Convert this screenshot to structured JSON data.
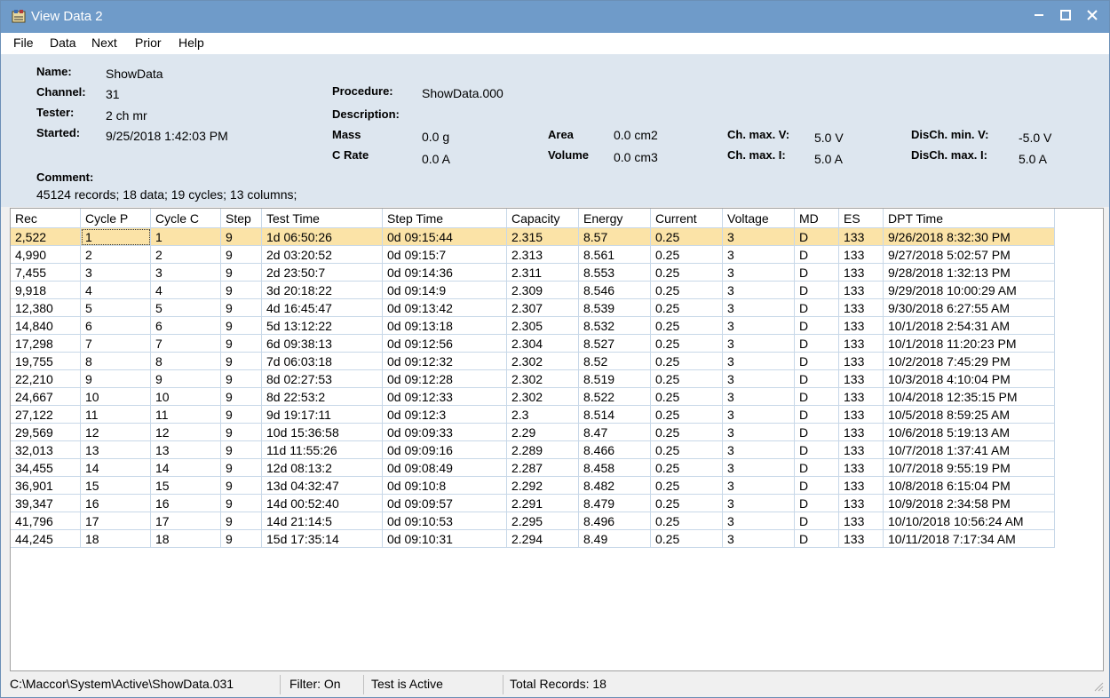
{
  "window": {
    "title": "View Data 2",
    "min": "−",
    "max": "☐",
    "close": "✕"
  },
  "menu": [
    "File",
    "Data",
    "Next",
    "Prior",
    "Help"
  ],
  "info": {
    "name_label": "Name:",
    "name": "ShowData",
    "channel_label": "Channel:",
    "channel": "31",
    "tester_label": "Tester:",
    "tester": "2 ch mr",
    "started_label": "Started:",
    "started": "9/25/2018 1:42:03 PM",
    "procedure_label": "Procedure:",
    "procedure": "ShowData.000",
    "description_label": "Description:",
    "mass_label": "Mass",
    "mass": "0.0 g",
    "crate_label": "C Rate",
    "crate": "0.0 A",
    "area_label": "Area",
    "area": "0.0 cm2",
    "volume_label": "Volume",
    "volume": "0.0 cm3",
    "chmaxv_label": "Ch. max. V:",
    "chmaxv": "5.0 V",
    "chmaxi_label": "Ch. max. I:",
    "chmaxi": "5.0 A",
    "dischminv_label": "DisCh. min. V:",
    "dischminv": "-5.0 V",
    "dischmaxi_label": "DisCh. max. I:",
    "dischmaxi": "5.0 A",
    "comment_label": "Comment:",
    "summary": "45124 records; 18 data; 19 cycles; 13 columns;"
  },
  "table": {
    "columns": [
      "Rec",
      "Cycle P",
      "Cycle C",
      "Step",
      "Test Time",
      "Step Time",
      "Capacity",
      "Energy",
      "Current",
      "Voltage",
      "MD",
      "ES",
      "DPT Time"
    ],
    "rows": [
      [
        "2,522",
        "1",
        "1",
        "9",
        "1d 06:50:26",
        "0d 09:15:44",
        "2.315",
        "8.57",
        "0.25",
        "3",
        "D",
        "133",
        "9/26/2018 8:32:30 PM"
      ],
      [
        "4,990",
        "2",
        "2",
        "9",
        "2d 03:20:52",
        "0d 09:15:7",
        "2.313",
        "8.561",
        "0.25",
        "3",
        "D",
        "133",
        "9/27/2018 5:02:57 PM"
      ],
      [
        "7,455",
        "3",
        "3",
        "9",
        "2d 23:50:7",
        "0d 09:14:36",
        "2.311",
        "8.553",
        "0.25",
        "3",
        "D",
        "133",
        "9/28/2018 1:32:13 PM"
      ],
      [
        "9,918",
        "4",
        "4",
        "9",
        "3d 20:18:22",
        "0d 09:14:9",
        "2.309",
        "8.546",
        "0.25",
        "3",
        "D",
        "133",
        "9/29/2018 10:00:29 AM"
      ],
      [
        "12,380",
        "5",
        "5",
        "9",
        "4d 16:45:47",
        "0d 09:13:42",
        "2.307",
        "8.539",
        "0.25",
        "3",
        "D",
        "133",
        "9/30/2018 6:27:55 AM"
      ],
      [
        "14,840",
        "6",
        "6",
        "9",
        "5d 13:12:22",
        "0d 09:13:18",
        "2.305",
        "8.532",
        "0.25",
        "3",
        "D",
        "133",
        "10/1/2018 2:54:31 AM"
      ],
      [
        "17,298",
        "7",
        "7",
        "9",
        "6d 09:38:13",
        "0d 09:12:56",
        "2.304",
        "8.527",
        "0.25",
        "3",
        "D",
        "133",
        "10/1/2018 11:20:23 PM"
      ],
      [
        "19,755",
        "8",
        "8",
        "9",
        "7d 06:03:18",
        "0d 09:12:32",
        "2.302",
        "8.52",
        "0.25",
        "3",
        "D",
        "133",
        "10/2/2018 7:45:29 PM"
      ],
      [
        "22,210",
        "9",
        "9",
        "9",
        "8d 02:27:53",
        "0d 09:12:28",
        "2.302",
        "8.519",
        "0.25",
        "3",
        "D",
        "133",
        "10/3/2018 4:10:04 PM"
      ],
      [
        "24,667",
        "10",
        "10",
        "9",
        "8d 22:53:2",
        "0d 09:12:33",
        "2.302",
        "8.522",
        "0.25",
        "3",
        "D",
        "133",
        "10/4/2018 12:35:15 PM"
      ],
      [
        "27,122",
        "11",
        "11",
        "9",
        "9d 19:17:11",
        "0d 09:12:3",
        "2.3",
        "8.514",
        "0.25",
        "3",
        "D",
        "133",
        "10/5/2018 8:59:25 AM"
      ],
      [
        "29,569",
        "12",
        "12",
        "9",
        "10d 15:36:58",
        "0d 09:09:33",
        "2.29",
        "8.47",
        "0.25",
        "3",
        "D",
        "133",
        "10/6/2018 5:19:13 AM"
      ],
      [
        "32,013",
        "13",
        "13",
        "9",
        "11d 11:55:26",
        "0d 09:09:16",
        "2.289",
        "8.466",
        "0.25",
        "3",
        "D",
        "133",
        "10/7/2018 1:37:41 AM"
      ],
      [
        "34,455",
        "14",
        "14",
        "9",
        "12d 08:13:2",
        "0d 09:08:49",
        "2.287",
        "8.458",
        "0.25",
        "3",
        "D",
        "133",
        "10/7/2018 9:55:19 PM"
      ],
      [
        "36,901",
        "15",
        "15",
        "9",
        "13d 04:32:47",
        "0d 09:10:8",
        "2.292",
        "8.482",
        "0.25",
        "3",
        "D",
        "133",
        "10/8/2018 6:15:04 PM"
      ],
      [
        "39,347",
        "16",
        "16",
        "9",
        "14d 00:52:40",
        "0d 09:09:57",
        "2.291",
        "8.479",
        "0.25",
        "3",
        "D",
        "133",
        "10/9/2018 2:34:58 PM"
      ],
      [
        "41,796",
        "17",
        "17",
        "9",
        "14d 21:14:5",
        "0d 09:10:53",
        "2.295",
        "8.496",
        "0.25",
        "3",
        "D",
        "133",
        "10/10/2018 10:56:24 AM"
      ],
      [
        "44,245",
        "18",
        "18",
        "9",
        "15d 17:35:14",
        "0d 09:10:31",
        "2.294",
        "8.49",
        "0.25",
        "3",
        "D",
        "133",
        "10/11/2018 7:17:34 AM"
      ]
    ],
    "selected_row": 0
  },
  "status": {
    "path": "C:\\Maccor\\System\\Active\\ShowData.031",
    "filter": "Filter: On",
    "test": "Test is Active",
    "total": "Total Records: 18"
  },
  "colors": {
    "titlebar": "#6f9bc9",
    "header_bg": "#dde6ef",
    "selected_row": "#fbe3a7"
  }
}
